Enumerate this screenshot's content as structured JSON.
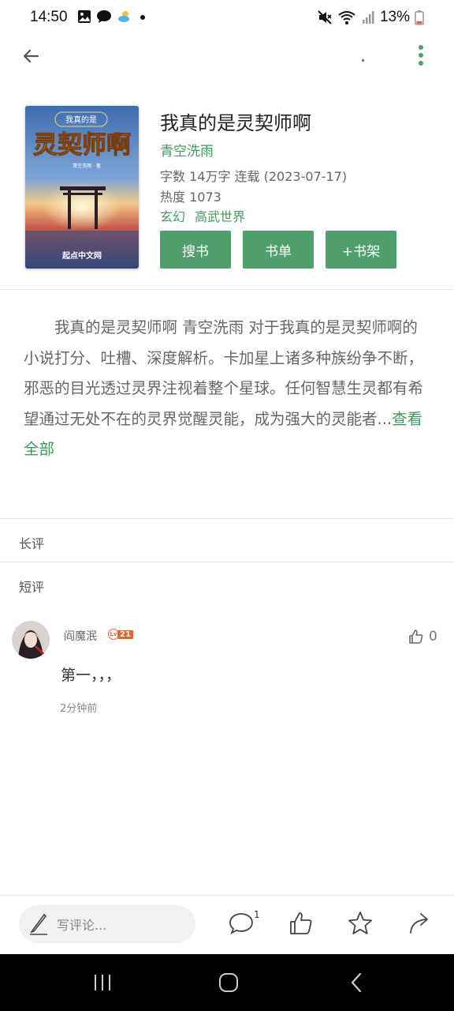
{
  "status_bar": {
    "time": "14:50",
    "battery": "13%",
    "icons": [
      "gallery-icon",
      "chat-icon",
      "weather-icon",
      "dot-icon",
      "mute-icon",
      "wifi-icon",
      "signal-icon",
      "battery-icon"
    ]
  },
  "top_bar": {
    "back_icon": "back-arrow-icon",
    "more_icon": "more-vertical-icon"
  },
  "book": {
    "cover_top_text": "我真的是",
    "cover_title": "灵契师啊",
    "cover_author": "青空洗雨 · 著",
    "cover_brand": "起点中文网",
    "title": "我真的是灵契师啊",
    "author": "青空洗雨",
    "meta_words": "字数 14万字  连载 (2023-07-17)",
    "meta_heat": "热度 1073",
    "tags": [
      "玄幻",
      "高武世界"
    ],
    "buttons": {
      "search": "搜书",
      "booklist": "书单",
      "shelf": "+书架"
    }
  },
  "description": {
    "text": "我真的是灵契师啊 青空洗雨 对于我真的是灵契师啊的小说打分、吐槽、深度解析。卡加星上诸多种族纷争不断，邪恶的目光透过灵界注视着整个星球。任何智慧生灵都有希望通过无处不在的灵界觉醒灵能，成为强大的灵能者...",
    "more": "查看全部"
  },
  "sections": {
    "long_review": "长评",
    "short_review": "短评"
  },
  "comment": {
    "user": "阎魔泯",
    "level": "21",
    "likes": "0",
    "text": "第一，，，",
    "time": "2分钟前"
  },
  "bottom_bar": {
    "placeholder": "写评论...",
    "comment_count": "1",
    "icons": [
      "pencil-icon",
      "comment-icon",
      "thumbs-up-icon",
      "star-icon",
      "share-icon"
    ]
  },
  "nav_bar": {
    "icons": [
      "recents-icon",
      "home-icon",
      "back-icon"
    ]
  },
  "colors": {
    "accent": "#4e9f6b",
    "link": "#3f9a5f",
    "level_badge": "#e8622a"
  }
}
